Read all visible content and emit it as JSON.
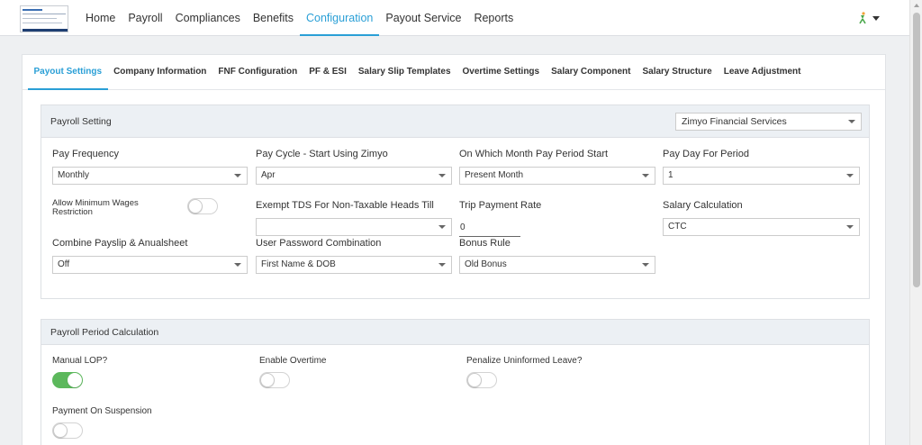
{
  "nav": {
    "items": [
      "Home",
      "Payroll",
      "Compliances",
      "Benefits",
      "Configuration",
      "Payout Service",
      "Reports"
    ],
    "active_index": 4
  },
  "subtabs": {
    "items": [
      "Payout Settings",
      "Company Information",
      "FNF Configuration",
      "PF & ESI",
      "Salary Slip Templates",
      "Overtime Settings",
      "Salary Component",
      "Salary Structure",
      "Leave Adjustment"
    ],
    "active_index": 0
  },
  "payroll_setting": {
    "title": "Payroll Setting",
    "company": "Zimyo Financial Services",
    "pay_frequency": {
      "label": "Pay Frequency",
      "value": "Monthly"
    },
    "pay_cycle": {
      "label": "Pay Cycle - Start Using Zimyo",
      "value": "Apr"
    },
    "pay_period_start": {
      "label": "On Which Month Pay Period Start",
      "value": "Present Month"
    },
    "pay_day": {
      "label": "Pay Day For Period",
      "value": "1"
    },
    "min_wages": {
      "label": "Allow Minimum Wages Restriction",
      "enabled": false
    },
    "exempt_tds": {
      "label": "Exempt TDS For Non-Taxable Heads Till",
      "value": ""
    },
    "trip_payment": {
      "label": "Trip Payment Rate",
      "value": "0"
    },
    "salary_calc": {
      "label": "Salary Calculation",
      "value": "CTC"
    },
    "combine_payslip": {
      "label": "Combine Payslip & Anualsheet",
      "value": "Off"
    },
    "password_combo": {
      "label": "User Password Combination",
      "value": "First Name & DOB"
    },
    "bonus_rule": {
      "label": "Bonus Rule",
      "value": "Old Bonus"
    }
  },
  "period_calc": {
    "title": "Payroll Period Calculation",
    "manual_lop": {
      "label": "Manual LOP?",
      "enabled": true
    },
    "enable_overtime": {
      "label": "Enable Overtime",
      "enabled": false
    },
    "penalize_leave": {
      "label": "Penalize Uninformed Leave?",
      "enabled": false
    },
    "payment_suspension": {
      "label": "Payment On Suspension",
      "enabled": false
    }
  },
  "colors": {
    "accent": "#2a9fd6",
    "toggle_on": "#5cb85c",
    "header_bg": "#ecf0f4"
  },
  "icons": {
    "user": "user-figure-icon",
    "caret": "chevron-down-icon"
  }
}
